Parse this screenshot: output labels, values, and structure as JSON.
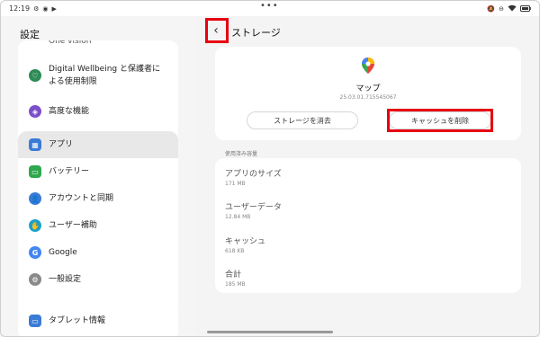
{
  "status_bar": {
    "time": "12:19",
    "left_icons": [
      "settings-gear-icon",
      "location-icon",
      "play-icon"
    ],
    "center_dots": "•••",
    "right_icons": [
      "mute-icon",
      "do-not-disturb-icon",
      "wifi-icon",
      "battery-icon"
    ]
  },
  "sidebar": {
    "title": "設定",
    "cutoff_item": "One vision",
    "group1": [
      {
        "label_line1": "Digital Wellbeing と保護者に",
        "label_line2": "よる使用制限",
        "icon": "digital-wellbeing-icon",
        "color": "#2e8b57"
      },
      {
        "label": "高度な機能",
        "icon": "advanced-features-icon",
        "color": "#7b4fc9"
      }
    ],
    "group2": [
      {
        "label": "アプリ",
        "icon": "apps-icon",
        "color": "#3a7bd5",
        "selected": true
      },
      {
        "label": "バッテリー",
        "icon": "battery-icon",
        "color": "#2fa84f"
      },
      {
        "label": "アカウントと同期",
        "icon": "account-icon",
        "color": "#3a7bd5"
      },
      {
        "label": "ユーザー補助",
        "icon": "accessibility-icon",
        "color": "#1aa1c9"
      },
      {
        "label": "Google",
        "icon": "google-icon",
        "color": "#4285f4"
      },
      {
        "label": "一般設定",
        "icon": "general-settings-icon",
        "color": "#8a8a8a"
      }
    ],
    "group3": [
      {
        "label": "タブレット情報",
        "icon": "tablet-info-icon",
        "color": "#3a7bd5"
      }
    ]
  },
  "header": {
    "back_icon": "back-chevron-icon",
    "title": "ストレージ"
  },
  "app": {
    "icon": "google-maps-icon",
    "name": "マップ",
    "version": "25.03.01.715545067",
    "clear_storage_label": "ストレージを消去",
    "clear_cache_label": "キャッシュを削除"
  },
  "usage": {
    "section_label": "使用済み容量",
    "rows": [
      {
        "title": "アプリのサイズ",
        "value": "171 MB"
      },
      {
        "title": "ユーザーデータ",
        "value": "12.84 MB"
      },
      {
        "title": "キャッシュ",
        "value": "618 KB"
      },
      {
        "title": "合計",
        "value": "185 MB"
      }
    ]
  },
  "colors": {
    "highlight": "#e60012",
    "maps_red": "#ea4335",
    "maps_blue": "#4285f4",
    "maps_yellow": "#fbbc04",
    "maps_green": "#34a853"
  }
}
